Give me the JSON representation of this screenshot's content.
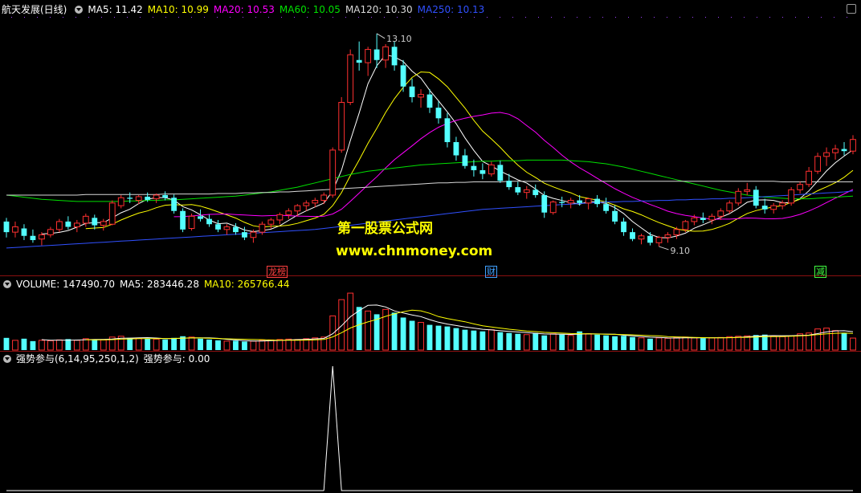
{
  "header": {
    "stock_name": "航天发展(日线)",
    "ma_items": [
      {
        "label": "MA5: 11.42",
        "color": "#ffffff"
      },
      {
        "label": "MA10: 10.99",
        "color": "#ffff00"
      },
      {
        "label": "MA20: 10.53",
        "color": "#ff00ff"
      },
      {
        "label": "MA60: 10.05",
        "color": "#00e000"
      },
      {
        "label": "MA120: 10.30",
        "color": "#d8d8d8"
      },
      {
        "label": "MA250: 10.13",
        "color": "#3050ff"
      }
    ]
  },
  "volume_header": {
    "items": [
      {
        "label": "VOLUME: 147490.70",
        "color": "#ffffff"
      },
      {
        "label": "MA5: 283446.28",
        "color": "#ffffff"
      },
      {
        "label": "MA10: 265766.44",
        "color": "#ffff00"
      }
    ]
  },
  "indicator_header": {
    "name": "强势参与(6,14,95,250,1,2)",
    "value": "强势参与: 0.00"
  },
  "watermark": {
    "line1": "第一股票公式网",
    "line2": "www.chnmoney.com"
  },
  "price_annotations": {
    "high": "13.10",
    "low": "9.10"
  },
  "event_tags": [
    {
      "text": "龙榜",
      "color": "#ff4040"
    },
    {
      "text": "财",
      "color": "#40a0ff"
    },
    {
      "text": "减",
      "color": "#40ff40"
    }
  ],
  "colors": {
    "up": "#ff3030",
    "down": "#54ffff",
    "separator": "#8b1010"
  },
  "chart_data": [
    {
      "type": "candlestick",
      "title": "航天发展(日线)",
      "ylim": [
        8.7,
        13.4
      ],
      "ohlc": [
        [
          9.55,
          9.62,
          9.25,
          9.35
        ],
        [
          9.35,
          9.55,
          9.25,
          9.45
        ],
        [
          9.42,
          9.5,
          9.2,
          9.28
        ],
        [
          9.28,
          9.4,
          9.15,
          9.2
        ],
        [
          9.22,
          9.35,
          9.1,
          9.3
        ],
        [
          9.3,
          9.45,
          9.25,
          9.4
        ],
        [
          9.4,
          9.6,
          9.35,
          9.55
        ],
        [
          9.55,
          9.65,
          9.4,
          9.45
        ],
        [
          9.45,
          9.58,
          9.35,
          9.52
        ],
        [
          9.52,
          9.7,
          9.45,
          9.65
        ],
        [
          9.62,
          9.68,
          9.4,
          9.48
        ],
        [
          9.48,
          9.6,
          9.38,
          9.55
        ],
        [
          9.5,
          9.95,
          9.48,
          9.9
        ],
        [
          9.85,
          10.05,
          9.8,
          10.0
        ],
        [
          10.0,
          10.1,
          9.9,
          9.98
        ],
        [
          9.95,
          10.05,
          9.88,
          10.02
        ],
        [
          10.02,
          10.1,
          9.92,
          9.96
        ],
        [
          9.98,
          10.08,
          9.9,
          10.05
        ],
        [
          10.05,
          10.12,
          9.95,
          10.0
        ],
        [
          10.0,
          10.06,
          9.7,
          9.75
        ],
        [
          9.75,
          9.8,
          9.35,
          9.4
        ],
        [
          9.42,
          9.7,
          9.38,
          9.65
        ],
        [
          9.65,
          9.78,
          9.55,
          9.6
        ],
        [
          9.6,
          9.68,
          9.45,
          9.5
        ],
        [
          9.5,
          9.58,
          9.35,
          9.4
        ],
        [
          9.4,
          9.5,
          9.3,
          9.45
        ],
        [
          9.45,
          9.52,
          9.3,
          9.35
        ],
        [
          9.35,
          9.45,
          9.2,
          9.25
        ],
        [
          9.25,
          9.4,
          9.15,
          9.35
        ],
        [
          9.35,
          9.55,
          9.3,
          9.5
        ],
        [
          9.5,
          9.62,
          9.42,
          9.58
        ],
        [
          9.58,
          9.72,
          9.5,
          9.68
        ],
        [
          9.68,
          9.8,
          9.6,
          9.75
        ],
        [
          9.75,
          9.88,
          9.65,
          9.85
        ],
        [
          9.85,
          9.95,
          9.75,
          9.9
        ],
        [
          9.9,
          10.0,
          9.82,
          9.95
        ],
        [
          9.95,
          10.1,
          9.88,
          10.05
        ],
        [
          10.05,
          10.95,
          10.0,
          10.9
        ],
        [
          10.9,
          11.9,
          10.85,
          11.8
        ],
        [
          11.8,
          12.8,
          11.75,
          12.7
        ],
        [
          12.6,
          12.95,
          12.4,
          12.55
        ],
        [
          12.55,
          12.85,
          12.3,
          12.8
        ],
        [
          12.8,
          13.1,
          12.45,
          12.6
        ],
        [
          12.6,
          12.9,
          12.45,
          12.85
        ],
        [
          12.85,
          12.95,
          12.4,
          12.5
        ],
        [
          12.5,
          12.6,
          12.0,
          12.1
        ],
        [
          12.1,
          12.25,
          11.8,
          11.9
        ],
        [
          11.9,
          12.05,
          11.7,
          11.95
        ],
        [
          11.95,
          12.05,
          11.6,
          11.7
        ],
        [
          11.7,
          11.82,
          11.4,
          11.5
        ],
        [
          11.5,
          11.6,
          10.95,
          11.05
        ],
        [
          11.05,
          11.15,
          10.7,
          10.8
        ],
        [
          10.8,
          10.92,
          10.55,
          10.6
        ],
        [
          10.6,
          10.72,
          10.4,
          10.52
        ],
        [
          10.52,
          10.65,
          10.35,
          10.45
        ],
        [
          10.45,
          10.68,
          10.4,
          10.62
        ],
        [
          10.62,
          10.7,
          10.28,
          10.32
        ],
        [
          10.32,
          10.45,
          10.15,
          10.2
        ],
        [
          10.2,
          10.3,
          10.05,
          10.1
        ],
        [
          10.1,
          10.22,
          9.98,
          10.15
        ],
        [
          10.15,
          10.25,
          10.0,
          10.05
        ],
        [
          10.05,
          10.12,
          9.62,
          9.72
        ],
        [
          9.72,
          9.95,
          9.68,
          9.92
        ],
        [
          9.92,
          10.02,
          9.82,
          9.9
        ],
        [
          9.9,
          10.0,
          9.8,
          9.95
        ],
        [
          9.95,
          10.05,
          9.85,
          9.9
        ],
        [
          9.9,
          10.0,
          9.78,
          9.98
        ],
        [
          9.98,
          10.05,
          9.82,
          9.88
        ],
        [
          9.88,
          10.0,
          9.7,
          9.75
        ],
        [
          9.75,
          9.85,
          9.5,
          9.55
        ],
        [
          9.55,
          9.62,
          9.28,
          9.35
        ],
        [
          9.35,
          9.42,
          9.18,
          9.22
        ],
        [
          9.22,
          9.32,
          9.12,
          9.28
        ],
        [
          9.28,
          9.35,
          9.1,
          9.15
        ],
        [
          9.15,
          9.28,
          9.08,
          9.25
        ],
        [
          9.25,
          9.35,
          9.15,
          9.3
        ],
        [
          9.3,
          9.45,
          9.22,
          9.4
        ],
        [
          9.4,
          9.58,
          9.35,
          9.55
        ],
        [
          9.55,
          9.68,
          9.48,
          9.62
        ],
        [
          9.62,
          9.72,
          9.52,
          9.58
        ],
        [
          9.58,
          9.7,
          9.5,
          9.65
        ],
        [
          9.65,
          9.8,
          9.58,
          9.75
        ],
        [
          9.75,
          9.95,
          9.7,
          9.9
        ],
        [
          9.9,
          10.18,
          9.85,
          10.12
        ],
        [
          10.12,
          10.28,
          10.05,
          10.15
        ],
        [
          10.15,
          10.22,
          9.8,
          9.85
        ],
        [
          9.85,
          9.98,
          9.7,
          9.78
        ],
        [
          9.78,
          9.9,
          9.7,
          9.85
        ],
        [
          9.85,
          9.95,
          9.78,
          9.9
        ],
        [
          9.9,
          10.2,
          9.85,
          10.15
        ],
        [
          10.15,
          10.3,
          10.08,
          10.25
        ],
        [
          10.25,
          10.58,
          10.2,
          10.5
        ],
        [
          10.5,
          10.85,
          10.45,
          10.78
        ],
        [
          10.78,
          10.95,
          10.6,
          10.85
        ],
        [
          10.85,
          11.0,
          10.72,
          10.92
        ],
        [
          10.92,
          11.05,
          10.8,
          10.88
        ],
        [
          10.88,
          11.18,
          10.82,
          11.1
        ]
      ],
      "ma_series": [
        {
          "name": "MA5",
          "period": 5,
          "color": "#ffffff"
        },
        {
          "name": "MA10",
          "period": 10,
          "color": "#ffff00"
        },
        {
          "name": "MA20",
          "period": 20,
          "color": "#ff00ff"
        },
        {
          "name": "MA60",
          "color": "#00e000",
          "values": [
            10.05,
            10.03,
            10.01,
            9.99,
            9.97,
            9.96,
            9.95,
            9.94,
            9.93,
            9.93,
            9.93,
            9.93,
            9.93,
            9.93,
            9.94,
            9.94,
            9.95,
            9.95,
            9.96,
            9.96,
            9.97,
            9.98,
            9.99,
            10.0,
            10.01,
            10.02,
            10.03,
            10.05,
            10.07,
            10.09,
            10.11,
            10.14,
            10.17,
            10.2,
            10.24,
            10.28,
            10.32,
            10.36,
            10.4,
            10.44,
            10.47,
            10.5,
            10.52,
            10.54,
            10.56,
            10.58,
            10.6,
            10.62,
            10.63,
            10.64,
            10.65,
            10.66,
            10.67,
            10.68,
            10.69,
            10.69,
            10.7,
            10.7,
            10.7,
            10.71,
            10.71,
            10.71,
            10.71,
            10.71,
            10.7,
            10.69,
            10.68,
            10.66,
            10.64,
            10.61,
            10.58,
            10.54,
            10.5,
            10.46,
            10.42,
            10.38,
            10.34,
            10.3,
            10.26,
            10.22,
            10.18,
            10.14,
            10.11,
            10.08,
            10.05,
            10.03,
            10.01,
            10.0,
            9.99,
            9.98,
            9.98,
            9.98,
            9.99,
            10.0,
            10.01,
            10.02,
            10.03
          ]
        },
        {
          "name": "MA120",
          "color": "#d8d8d8",
          "values": [
            10.05,
            10.05,
            10.05,
            10.05,
            10.05,
            10.05,
            10.05,
            10.05,
            10.05,
            10.06,
            10.06,
            10.06,
            10.06,
            10.06,
            10.06,
            10.06,
            10.06,
            10.06,
            10.07,
            10.07,
            10.07,
            10.07,
            10.07,
            10.07,
            10.08,
            10.08,
            10.08,
            10.09,
            10.09,
            10.1,
            10.1,
            10.11,
            10.11,
            10.12,
            10.13,
            10.14,
            10.15,
            10.16,
            10.17,
            10.18,
            10.19,
            10.2,
            10.21,
            10.22,
            10.23,
            10.24,
            10.25,
            10.26,
            10.27,
            10.28,
            10.28,
            10.29,
            10.29,
            10.3,
            10.3,
            10.3,
            10.3,
            10.31,
            10.31,
            10.31,
            10.31,
            10.31,
            10.31,
            10.31,
            10.31,
            10.31,
            10.31,
            10.31,
            10.31,
            10.31,
            10.31,
            10.31,
            10.31,
            10.31,
            10.31,
            10.31,
            10.31,
            10.31,
            10.31,
            10.31,
            10.31,
            10.31,
            10.31,
            10.31,
            10.31,
            10.31,
            10.31,
            10.31,
            10.3,
            10.3,
            10.3,
            10.3,
            10.3,
            10.3,
            10.3,
            10.3,
            10.3
          ]
        },
        {
          "name": "MA250",
          "color": "#3050ff",
          "values": [
            9.05,
            9.06,
            9.07,
            9.08,
            9.09,
            9.1,
            9.11,
            9.12,
            9.13,
            9.14,
            9.15,
            9.16,
            9.17,
            9.18,
            9.19,
            9.2,
            9.21,
            9.22,
            9.23,
            9.24,
            9.25,
            9.26,
            9.27,
            9.28,
            9.29,
            9.3,
            9.31,
            9.32,
            9.33,
            9.34,
            9.35,
            9.36,
            9.37,
            9.38,
            9.39,
            9.4,
            9.42,
            9.44,
            9.46,
            9.48,
            9.5,
            9.52,
            9.54,
            9.56,
            9.58,
            9.6,
            9.62,
            9.64,
            9.66,
            9.68,
            9.7,
            9.72,
            9.74,
            9.76,
            9.78,
            9.79,
            9.8,
            9.81,
            9.82,
            9.83,
            9.84,
            9.85,
            9.86,
            9.87,
            9.88,
            9.89,
            9.9,
            9.91,
            9.92,
            9.92,
            9.93,
            9.93,
            9.94,
            9.94,
            9.95,
            9.95,
            9.96,
            9.96,
            9.97,
            9.97,
            9.98,
            9.98,
            9.99,
            9.99,
            10.0,
            10.01,
            10.02,
            10.03,
            10.04,
            10.05,
            10.06,
            10.07,
            10.08,
            10.09,
            10.1,
            10.11,
            10.13
          ]
        }
      ]
    },
    {
      "type": "bar",
      "title": "VOLUME",
      "ylim": [
        0,
        750000
      ],
      "values": [
        150000,
        120000,
        140000,
        110000,
        120000,
        115000,
        125000,
        135000,
        120000,
        140000,
        130000,
        125000,
        160000,
        170000,
        150000,
        145000,
        140000,
        135000,
        130000,
        150000,
        170000,
        160000,
        140000,
        130000,
        120000,
        110000,
        115000,
        105000,
        110000,
        120000,
        125000,
        130000,
        135000,
        130000,
        140000,
        150000,
        160000,
        420000,
        620000,
        700000,
        530000,
        480000,
        440000,
        500000,
        460000,
        400000,
        360000,
        340000,
        310000,
        300000,
        290000,
        270000,
        250000,
        240000,
        230000,
        250000,
        220000,
        210000,
        200000,
        190000,
        210000,
        180000,
        200000,
        190000,
        180000,
        230000,
        200000,
        190000,
        180000,
        170000,
        175000,
        160000,
        150000,
        140000,
        150000,
        145000,
        155000,
        160000,
        150000,
        145000,
        150000,
        155000,
        165000,
        170000,
        175000,
        185000,
        190000,
        170000,
        165000,
        175000,
        200000,
        210000,
        260000,
        270000,
        240000,
        210000,
        147490
      ],
      "ma_series": [
        {
          "name": "MA5",
          "period": 5,
          "color": "#ffffff"
        },
        {
          "name": "MA10",
          "period": 10,
          "color": "#ffff00"
        }
      ]
    },
    {
      "type": "line",
      "title": "强势参与",
      "ylim": [
        0,
        1
      ],
      "values": [
        0,
        0,
        0,
        0,
        0,
        0,
        0,
        0,
        0,
        0,
        0,
        0,
        0,
        0,
        0,
        0,
        0,
        0,
        0,
        0,
        0,
        0,
        0,
        0,
        0,
        0,
        0,
        0,
        0,
        0,
        0,
        0,
        0,
        0,
        0,
        0,
        0,
        1,
        0,
        0,
        0,
        0,
        0,
        0,
        0,
        0,
        0,
        0,
        0,
        0,
        0,
        0,
        0,
        0,
        0,
        0,
        0,
        0,
        0,
        0,
        0,
        0,
        0,
        0,
        0,
        0,
        0,
        0,
        0,
        0,
        0,
        0,
        0,
        0,
        0,
        0,
        0,
        0,
        0,
        0,
        0,
        0,
        0,
        0,
        0,
        0,
        0,
        0,
        0,
        0,
        0,
        0,
        0,
        0,
        0,
        0,
        0
      ]
    }
  ]
}
